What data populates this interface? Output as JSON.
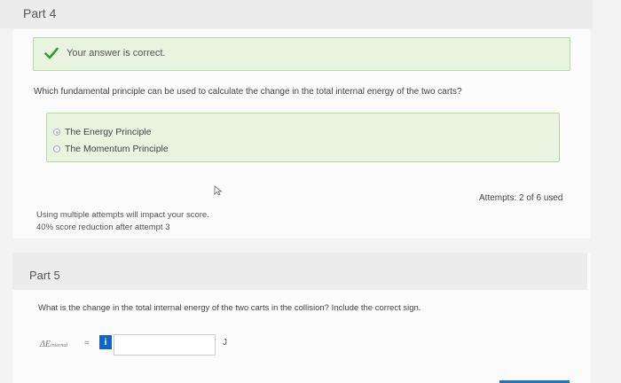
{
  "part4": {
    "title": "Part 4",
    "feedback": "Your answer is correct.",
    "question": "Which fundamental principle can be used to calculate the change in the total internal energy of the two carts?",
    "options": [
      {
        "label": "The Energy Principle",
        "selected": true
      },
      {
        "label": "The Momentum Principle",
        "selected": false
      }
    ],
    "attempts": "Attempts: 2 of 6 used",
    "note_line1": "Using multiple attempts will impact your score.",
    "note_line2": "40% score reduction after attempt 3"
  },
  "part5": {
    "title": "Part 5",
    "question": "What is the change in the total internal energy of the two carts in the collision? Include the correct sign.",
    "variable_main": "ΔE",
    "variable_sub": "internal",
    "equals": "=",
    "info_label": "i",
    "answer_value": "",
    "unit": "J"
  },
  "colors": {
    "correct_bg": "#e8f3e0",
    "correct_border": "#b9d7a6",
    "check_green": "#3a9a2b",
    "info_blue": "#1565c0"
  },
  "icons": [
    "check-icon",
    "cursor-icon",
    "info-icon"
  ]
}
